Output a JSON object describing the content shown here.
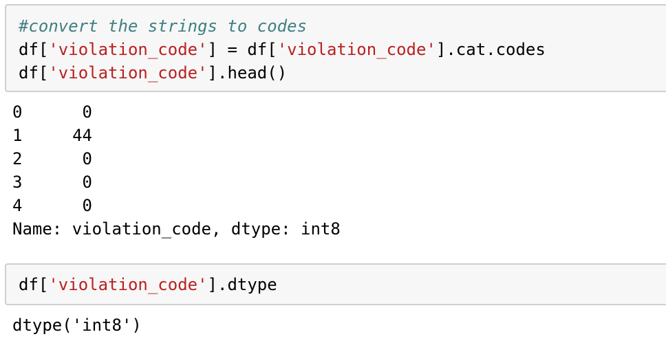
{
  "cell1": {
    "comment": "#convert the strings to codes",
    "line2": {
      "p1": "df[",
      "s1": "'violation_code'",
      "p2": "] = df[",
      "s2": "'violation_code'",
      "p3": "].cat.codes"
    },
    "line3": {
      "p1": "df[",
      "s1": "'violation_code'",
      "p2": "].head()"
    }
  },
  "output1": {
    "rows": [
      {
        "index": "0",
        "value": "0"
      },
      {
        "index": "1",
        "value": "44"
      },
      {
        "index": "2",
        "value": "0"
      },
      {
        "index": "3",
        "value": "0"
      },
      {
        "index": "4",
        "value": "0"
      }
    ],
    "footer": "Name: violation_code, dtype: int8"
  },
  "cell2": {
    "line1": {
      "p1": "df[",
      "s1": "'violation_code'",
      "p2": "].dtype"
    }
  },
  "output2": {
    "text": "dtype('int8')"
  }
}
